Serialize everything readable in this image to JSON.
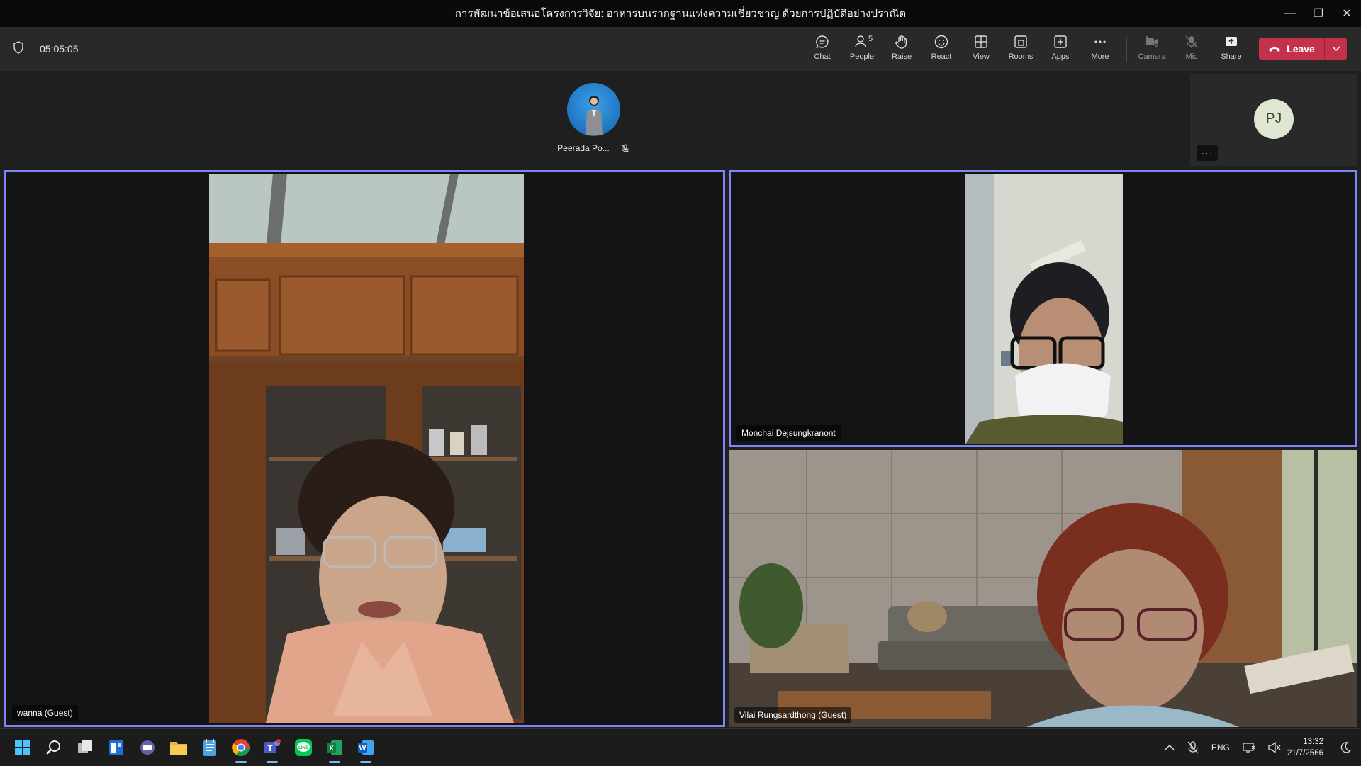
{
  "window": {
    "title": "การพัฒนาข้อเสนอโครงการวิจัย: อาหารบนรากฐานแห่งความเชี่ยวชาญ ด้วยการปฏิบัติอย่างปราณีต",
    "minimize": "—",
    "restore": "❐",
    "close": "✕"
  },
  "toolbar": {
    "timer": "05:05:05",
    "people_count": "5",
    "buttons": [
      {
        "id": "chat",
        "label": "Chat",
        "icon": "chat-icon"
      },
      {
        "id": "people",
        "label": "People",
        "icon": "people-icon"
      },
      {
        "id": "raise",
        "label": "Raise",
        "icon": "hand-icon"
      },
      {
        "id": "react",
        "label": "React",
        "icon": "smiley-icon"
      },
      {
        "id": "view",
        "label": "View",
        "icon": "grid-icon"
      },
      {
        "id": "rooms",
        "label": "Rooms",
        "icon": "rooms-icon"
      },
      {
        "id": "apps",
        "label": "Apps",
        "icon": "apps-icon"
      },
      {
        "id": "more",
        "label": "More",
        "icon": "ellipsis-icon"
      },
      {
        "id": "camera",
        "label": "Camera",
        "icon": "camera-off-icon"
      },
      {
        "id": "mic",
        "label": "Mic",
        "icon": "mic-off-icon"
      },
      {
        "id": "share",
        "label": "Share",
        "icon": "share-icon"
      }
    ],
    "leave_label": "Leave"
  },
  "stage": {
    "presenter_name": "Peerada Po...",
    "overflow_initials": "PJ",
    "overflow_more": "···",
    "tiles": [
      {
        "name": "wanna (Guest)"
      },
      {
        "name": "Monchai Dejsungkranont"
      },
      {
        "name": "Vilai Rungsardthong (Guest)"
      }
    ]
  },
  "taskbar": {
    "apps": [
      "windows-start-icon",
      "search-icon",
      "task-view-icon",
      "widgets-icon",
      "teams-chat-icon",
      "file-explorer-icon",
      "notepad-icon",
      "chrome-icon",
      "teams-icon",
      "line-icon",
      "excel-icon",
      "word-icon"
    ],
    "language": "ENG",
    "time": "13:32",
    "date": "21/7/2566"
  },
  "colors": {
    "accent": "#7f85f5",
    "leave": "#c4314b",
    "toolbar": "#292929",
    "stage": "#1f1f1f"
  }
}
